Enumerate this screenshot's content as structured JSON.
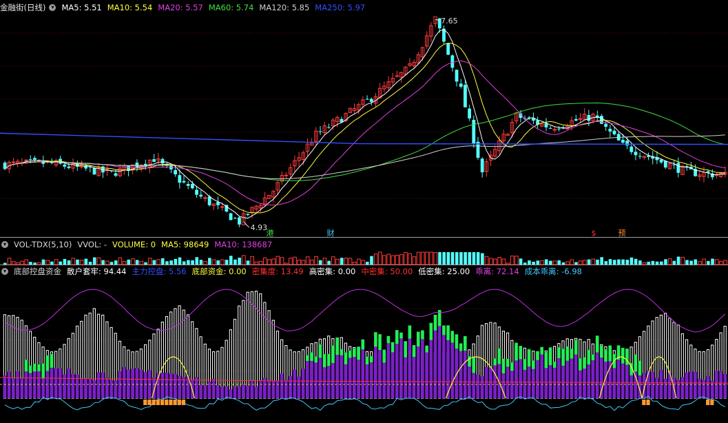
{
  "main_panel": {
    "title": "金融街(日线)",
    "ma": [
      {
        "label": "MA5: 5.51",
        "color": "#ffffff"
      },
      {
        "label": "MA10: 5.54",
        "color": "#ffff3c"
      },
      {
        "label": "MA20: 5.57",
        "color": "#e040e0"
      },
      {
        "label": "MA60: 5.74",
        "color": "#40e040"
      },
      {
        "label": "MA120: 5.85",
        "color": "#d0d0d0"
      },
      {
        "label": "MA250: 5.97",
        "color": "#3050ff"
      }
    ],
    "high_label": "7.65",
    "low_label": "4.93",
    "markers": [
      {
        "text": "港",
        "color": "#40e040"
      },
      {
        "text": "财",
        "color": "#3fc8ff"
      },
      {
        "text": "$",
        "color": "#ff3030"
      },
      {
        "text": "预",
        "color": "#ff8c30"
      }
    ]
  },
  "volume_panel": {
    "items": [
      {
        "label": "VOL-TDX(5,10)",
        "color": "#d8d8d8"
      },
      {
        "label": "VVOL: -",
        "color": "#d8d8d8"
      },
      {
        "label": "VOLUME: 0",
        "color": "#ffff3c"
      },
      {
        "label": "MA5: 98649",
        "color": "#ffff3c"
      },
      {
        "label": "MA10: 138687",
        "color": "#e040e0"
      }
    ]
  },
  "indicator_panel": {
    "items": [
      {
        "label": "底部控盘资金",
        "color": "#d8d8d8"
      },
      {
        "label": "散户套牢: 94.44",
        "color": "#ffffff"
      },
      {
        "label": "主力控盘: 5.56",
        "color": "#3050ff"
      },
      {
        "label": "底部资金: 0.00",
        "color": "#ffff3c"
      },
      {
        "label": "密集度: 13.49",
        "color": "#ff3030"
      },
      {
        "label": "高密集: 0.00",
        "color": "#ffffff"
      },
      {
        "label": "中密集: 50.00",
        "color": "#ff3030"
      },
      {
        "label": "低密集: 25.00",
        "color": "#ffffff"
      },
      {
        "label": "乖离: 72.14",
        "color": "#e040e0"
      },
      {
        "label": "成本乖离: -6.98",
        "color": "#3fc8ff"
      }
    ]
  },
  "chart_data": {
    "type": "candlestick",
    "bars": 170,
    "price_range": [
      4.93,
      7.65
    ],
    "high": 7.65,
    "low": 4.93,
    "ma_last": {
      "MA5": 5.51,
      "MA10": 5.54,
      "MA20": 5.57,
      "MA60": 5.74,
      "MA120": 5.85,
      "MA250": 5.97
    },
    "volume_ma": {
      "MA5": 98649,
      "MA10": 138687
    },
    "indicator_last": {
      "散户套牢": 94.44,
      "主力控盘": 5.56,
      "底部资金": 0.0,
      "密集度": 13.49,
      "高密集": 0.0,
      "中密集": 50.0,
      "低密集": 25.0,
      "乖离": 72.14,
      "成本乖离": -6.98
    },
    "colors": {
      "up": "#ff3c3c",
      "down": "#54ffff",
      "bg": "#000000",
      "purple": "#7a1fc8",
      "green": "#22ee55"
    }
  }
}
